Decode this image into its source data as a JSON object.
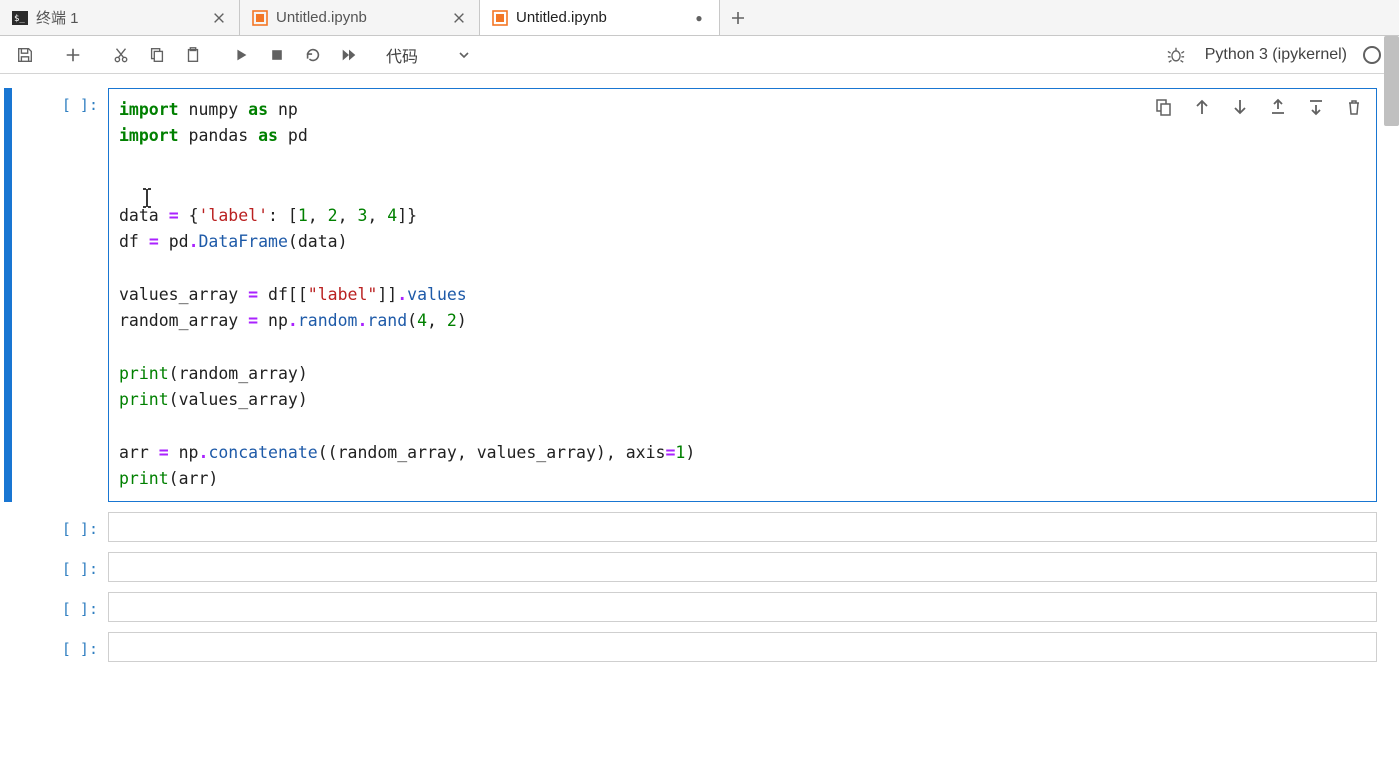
{
  "tabs": [
    {
      "label": "终端 1",
      "kind": "terminal",
      "active": false,
      "dirty": false
    },
    {
      "label": "Untitled.ipynb",
      "kind": "notebook",
      "active": false,
      "dirty": false
    },
    {
      "label": "Untitled.ipynb",
      "kind": "notebook",
      "active": true,
      "dirty": true
    }
  ],
  "toolbar": {
    "celltype_label": "代码",
    "kernel_label": "Python 3 (ipykernel)"
  },
  "cells": [
    {
      "prompt": "[ ]:",
      "active": true,
      "code_tokens": [
        [
          {
            "t": "kw",
            "v": "import"
          },
          {
            "t": "sp",
            "v": " "
          },
          {
            "t": "name",
            "v": "numpy"
          },
          {
            "t": "sp",
            "v": " "
          },
          {
            "t": "kw",
            "v": "as"
          },
          {
            "t": "sp",
            "v": " "
          },
          {
            "t": "name",
            "v": "np"
          }
        ],
        [
          {
            "t": "kw",
            "v": "import"
          },
          {
            "t": "sp",
            "v": " "
          },
          {
            "t": "name",
            "v": "pandas"
          },
          {
            "t": "sp",
            "v": " "
          },
          {
            "t": "kw",
            "v": "as"
          },
          {
            "t": "sp",
            "v": " "
          },
          {
            "t": "name",
            "v": "pd"
          }
        ],
        [],
        [],
        [
          {
            "t": "name",
            "v": "data"
          },
          {
            "t": "sp",
            "v": " "
          },
          {
            "t": "op",
            "v": "="
          },
          {
            "t": "sp",
            "v": " "
          },
          {
            "t": "punc",
            "v": "{"
          },
          {
            "t": "str",
            "v": "'label'"
          },
          {
            "t": "punc",
            "v": ":"
          },
          {
            "t": "sp",
            "v": " "
          },
          {
            "t": "punc",
            "v": "["
          },
          {
            "t": "num",
            "v": "1"
          },
          {
            "t": "punc",
            "v": ","
          },
          {
            "t": "sp",
            "v": " "
          },
          {
            "t": "num",
            "v": "2"
          },
          {
            "t": "punc",
            "v": ","
          },
          {
            "t": "sp",
            "v": " "
          },
          {
            "t": "num",
            "v": "3"
          },
          {
            "t": "punc",
            "v": ","
          },
          {
            "t": "sp",
            "v": " "
          },
          {
            "t": "num",
            "v": "4"
          },
          {
            "t": "punc",
            "v": "]"
          },
          {
            "t": "punc",
            "v": "}"
          }
        ],
        [
          {
            "t": "name",
            "v": "df"
          },
          {
            "t": "sp",
            "v": " "
          },
          {
            "t": "op",
            "v": "="
          },
          {
            "t": "sp",
            "v": " "
          },
          {
            "t": "name",
            "v": "pd"
          },
          {
            "t": "op",
            "v": "."
          },
          {
            "t": "attr",
            "v": "DataFrame"
          },
          {
            "t": "punc",
            "v": "("
          },
          {
            "t": "name",
            "v": "data"
          },
          {
            "t": "punc",
            "v": ")"
          }
        ],
        [],
        [
          {
            "t": "name",
            "v": "values_array"
          },
          {
            "t": "sp",
            "v": " "
          },
          {
            "t": "op",
            "v": "="
          },
          {
            "t": "sp",
            "v": " "
          },
          {
            "t": "name",
            "v": "df"
          },
          {
            "t": "punc",
            "v": "[["
          },
          {
            "t": "str",
            "v": "\"label\""
          },
          {
            "t": "punc",
            "v": "]]"
          },
          {
            "t": "op",
            "v": "."
          },
          {
            "t": "attr",
            "v": "values"
          }
        ],
        [
          {
            "t": "name",
            "v": "random_array"
          },
          {
            "t": "sp",
            "v": " "
          },
          {
            "t": "op",
            "v": "="
          },
          {
            "t": "sp",
            "v": " "
          },
          {
            "t": "name",
            "v": "np"
          },
          {
            "t": "op",
            "v": "."
          },
          {
            "t": "attr",
            "v": "random"
          },
          {
            "t": "op",
            "v": "."
          },
          {
            "t": "attr",
            "v": "rand"
          },
          {
            "t": "punc",
            "v": "("
          },
          {
            "t": "num",
            "v": "4"
          },
          {
            "t": "punc",
            "v": ","
          },
          {
            "t": "sp",
            "v": " "
          },
          {
            "t": "num",
            "v": "2"
          },
          {
            "t": "punc",
            "v": ")"
          }
        ],
        [],
        [
          {
            "t": "builtin",
            "v": "print"
          },
          {
            "t": "punc",
            "v": "("
          },
          {
            "t": "name",
            "v": "random_array"
          },
          {
            "t": "punc",
            "v": ")"
          }
        ],
        [
          {
            "t": "builtin",
            "v": "print"
          },
          {
            "t": "punc",
            "v": "("
          },
          {
            "t": "name",
            "v": "values_array"
          },
          {
            "t": "punc",
            "v": ")"
          }
        ],
        [],
        [
          {
            "t": "name",
            "v": "arr"
          },
          {
            "t": "sp",
            "v": " "
          },
          {
            "t": "op",
            "v": "="
          },
          {
            "t": "sp",
            "v": " "
          },
          {
            "t": "name",
            "v": "np"
          },
          {
            "t": "op",
            "v": "."
          },
          {
            "t": "attr",
            "v": "concatenate"
          },
          {
            "t": "punc",
            "v": "(("
          },
          {
            "t": "name",
            "v": "random_array"
          },
          {
            "t": "punc",
            "v": ","
          },
          {
            "t": "sp",
            "v": " "
          },
          {
            "t": "name",
            "v": "values_array"
          },
          {
            "t": "punc",
            "v": ")"
          },
          {
            "t": "punc",
            "v": ","
          },
          {
            "t": "sp",
            "v": " "
          },
          {
            "t": "name",
            "v": "axis"
          },
          {
            "t": "op",
            "v": "="
          },
          {
            "t": "num",
            "v": "1"
          },
          {
            "t": "punc",
            "v": ")"
          }
        ],
        [
          {
            "t": "builtin",
            "v": "print"
          },
          {
            "t": "punc",
            "v": "("
          },
          {
            "t": "name",
            "v": "arr"
          },
          {
            "t": "punc",
            "v": ")"
          }
        ]
      ]
    },
    {
      "prompt": "[ ]:",
      "active": false,
      "code_tokens": [
        []
      ]
    },
    {
      "prompt": "[ ]:",
      "active": false,
      "code_tokens": [
        []
      ]
    },
    {
      "prompt": "[ ]:",
      "active": false,
      "code_tokens": [
        []
      ]
    },
    {
      "prompt": "[ ]:",
      "active": false,
      "code_tokens": [
        []
      ]
    }
  ]
}
